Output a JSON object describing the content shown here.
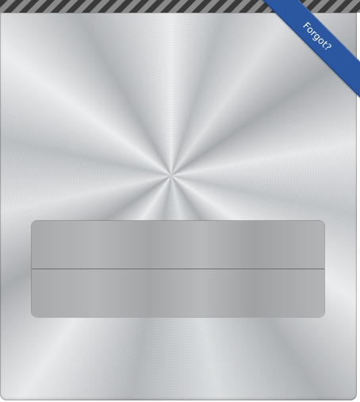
{
  "ribbon": {
    "label": "Forgot?"
  },
  "login_form": {
    "username": {
      "value": "",
      "placeholder": ""
    },
    "password": {
      "value": "",
      "placeholder": ""
    }
  },
  "colors": {
    "ribbon": "#2a57a0",
    "stripe_dark": "#3a3a3a",
    "stripe_light": "#8a8a8a",
    "field": "#acaeb0"
  }
}
